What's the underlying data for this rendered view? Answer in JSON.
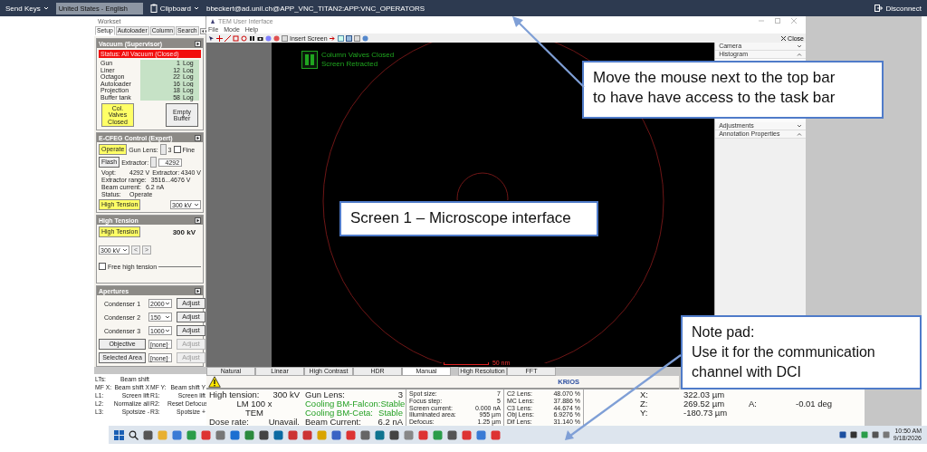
{
  "top_bar": {
    "send_keys": "Send Keys",
    "language": "United States - English",
    "clipboard": "Clipboard",
    "session": "bbeckert@ad.unil.ch@APP_VNC_TITAN2:APP:VNC_OPERATORS",
    "disconnect": "Disconnect"
  },
  "window": {
    "title": "TEM User Interface",
    "menu": [
      "File",
      "Mode",
      "Help"
    ],
    "toolbar_label": "Insert Screen",
    "close": "Close"
  },
  "workset": {
    "title": "Workset",
    "tabs": [
      {
        "label": "Setup",
        "selected": true
      },
      {
        "label": "Autoloader",
        "selected": false
      },
      {
        "label": "Column",
        "selected": false
      },
      {
        "label": "Search",
        "selected": false
      }
    ]
  },
  "vacuum": {
    "title": "Vacuum (Supervisor)",
    "status": "Status: All Vacuum (Closed)",
    "gauges": [
      {
        "name": "Gun",
        "value": "1",
        "unit": "Log"
      },
      {
        "name": "Liner",
        "value": "12",
        "unit": "Log"
      },
      {
        "name": "Octagon",
        "value": "22",
        "unit": "Log"
      },
      {
        "name": "Autoloader",
        "value": "16",
        "unit": "Log"
      },
      {
        "name": "Projection",
        "value": "18",
        "unit": "Log"
      },
      {
        "name": "Buffer tank",
        "value": "58",
        "unit": "Log"
      }
    ],
    "buttons": [
      {
        "label": "Col. Valves Closed",
        "active": true
      },
      {
        "label": "Empty Buffer",
        "active": false
      }
    ]
  },
  "cfeg": {
    "title": "E-CFEG Control (Expert)",
    "operate": {
      "label": "Operate",
      "active": true
    },
    "gun_lens_label": "Gun Lens:",
    "gun_lens": "3",
    "fine": {
      "label": "Fine",
      "checked": false
    },
    "flash": {
      "label": "Flash",
      "active": false
    },
    "extractor_label": "Extractor:",
    "extractor": "4292",
    "readings": [
      [
        {
          "label": "Vopt:",
          "value": "4292 V"
        },
        {
          "label": "Extractor:",
          "value": "4340 V"
        }
      ],
      [
        {
          "label": "Extractor range:",
          "value": "3516...4676 V"
        }
      ],
      [
        {
          "label": "Beam current:",
          "value": "6.2 nA"
        }
      ],
      [
        {
          "label": "Status:",
          "value": "Operate"
        }
      ]
    ],
    "ht_button": {
      "label": "High Tension",
      "active": true
    },
    "ht_select": "300 kV"
  },
  "high_tension": {
    "title": "High Tension",
    "button": {
      "label": "High Tension",
      "active": true
    },
    "value": "300 kV",
    "select": "300 kV",
    "prev": "<",
    "next": ">",
    "free": {
      "label": "Free high tension",
      "checked": false
    }
  },
  "apertures": {
    "title": "Apertures",
    "rows": [
      {
        "kind": "label",
        "name": "Condenser 1",
        "value": "2000",
        "adjust": "Adjust",
        "disabled": false
      },
      {
        "kind": "label",
        "name": "Condenser 2",
        "value": "150",
        "adjust": "Adjust",
        "disabled": false
      },
      {
        "kind": "label",
        "name": "Condenser 3",
        "value": "1000",
        "adjust": "Adjust",
        "disabled": false
      },
      {
        "kind": "button",
        "name": "Objective",
        "value": "[none]",
        "adjust": "Adjust",
        "disabled": true
      },
      {
        "kind": "button",
        "name": "Selected Area",
        "value": "[none]",
        "adjust": "Adjust",
        "disabled": true
      }
    ]
  },
  "image": {
    "status": [
      "Column Valves Closed",
      "Screen Retracted"
    ],
    "scale": "50 nm"
  },
  "side_panel": {
    "sections": [
      {
        "label": "Camera",
        "expanded": false
      },
      {
        "label": "Histogram",
        "expanded": true
      },
      {
        "label": "Adjustments",
        "expanded": false
      },
      {
        "label": "Annotation Properties",
        "expanded": true
      }
    ]
  },
  "display_tabs": [
    {
      "label": "Natural",
      "selected": false
    },
    {
      "label": "Linear",
      "selected": false
    },
    {
      "label": "High Contrast",
      "selected": false
    },
    {
      "label": "HDR",
      "selected": false
    },
    {
      "label": "Manual",
      "selected": true
    },
    {
      "label": "High Resolution",
      "selected": false
    },
    {
      "label": "FFT",
      "selected": false
    }
  ],
  "shortcuts": [
    [
      {
        "key": "LTs:",
        "action": "Beam shift"
      }
    ],
    [
      {
        "key": "MF X:",
        "action": "Beam shift X"
      },
      {
        "key": "MF Y:",
        "action": "Beam shift Y"
      }
    ],
    [
      {
        "key": "L1:",
        "action": "Screen lift"
      },
      {
        "key": "R1:",
        "action": "Screen lift"
      }
    ],
    [
      {
        "key": "L2:",
        "action": "Normalize all"
      },
      {
        "key": "R2:",
        "action": "Reset Defocus"
      }
    ],
    [
      {
        "key": "L3:",
        "action": "Spotsize -"
      },
      {
        "key": "R3:",
        "action": "Spotsize +"
      }
    ]
  ],
  "status_title": "KRIOS",
  "readouts": {
    "main": [
      {
        "kind": "pair",
        "label": "High tension:",
        "value": "300 kV"
      },
      {
        "kind": "center",
        "value": "LM 100 x"
      },
      {
        "kind": "center",
        "value": "TEM"
      },
      {
        "kind": "pair",
        "label": "Dose rate:",
        "value": "Unavail."
      }
    ],
    "gun": [
      {
        "label": "Gun Lens:",
        "value": "3",
        "ok": false
      },
      {
        "label": "Cooling BM-Falcon:",
        "value": "Stable",
        "ok": true
      },
      {
        "label": "Cooling BM-Ceta:",
        "value": "Stable",
        "ok": true
      },
      {
        "label": "Beam Current:",
        "value": "6.2 nA",
        "ok": false
      }
    ],
    "optics": [
      {
        "label": "Spot size:",
        "value": "7"
      },
      {
        "label": "Focus step:",
        "value": "5"
      },
      {
        "label": "Screen current:",
        "value": "0.000 nA"
      },
      {
        "label": "Illuminated area:",
        "value": "955 µm"
      },
      {
        "label": "Defocus:",
        "value": "1.25 µm"
      }
    ],
    "lenses": [
      {
        "label": "C2 Lens:",
        "value": "48.070 %"
      },
      {
        "label": "MC Lens:",
        "value": "37.886 %"
      },
      {
        "label": "C3 Lens:",
        "value": "44.674 %"
      },
      {
        "label": "Obj Lens:",
        "value": "6.9276 %"
      },
      {
        "label": "Dif Lens:",
        "value": "31.140 %"
      }
    ],
    "stage": [
      [
        {
          "label": "X:",
          "value": "322.03 µm"
        }
      ],
      [
        {
          "label": "Z:",
          "value": "269.52 µm"
        },
        {
          "label": "A:",
          "value": "-0.01 deg"
        }
      ],
      [
        {
          "label": "Y:",
          "value": "-180.73 µm"
        }
      ]
    ]
  },
  "callouts": [
    {
      "kind": "top",
      "lines": [
        "Move the mouse next to the top bar",
        "to have have access to the task bar"
      ]
    },
    {
      "kind": "center",
      "lines": [
        "Screen 1 – Microscope interface"
      ]
    },
    {
      "kind": "note",
      "lines": [
        "Note pad:",
        "Use it for the communication",
        "channel with DCI"
      ]
    }
  ],
  "taskbar": {
    "time": "10:50 AM",
    "date": "9/18/2026"
  }
}
